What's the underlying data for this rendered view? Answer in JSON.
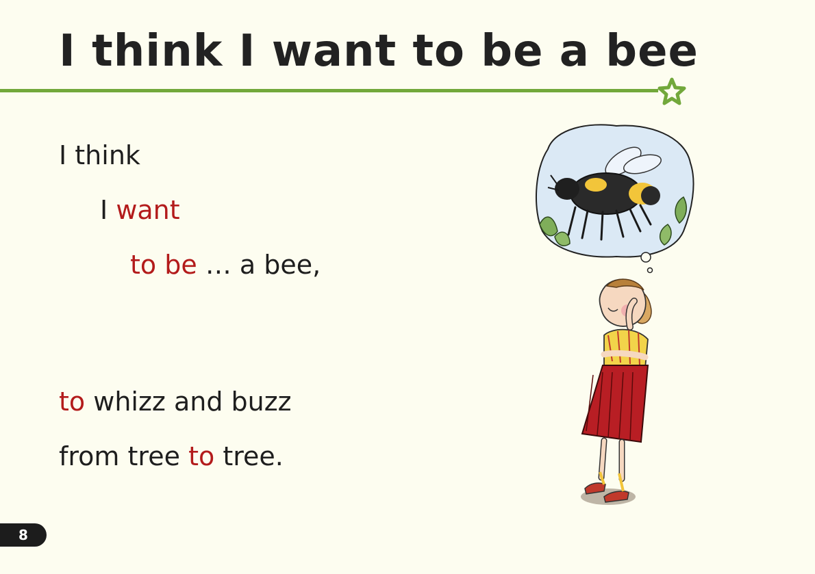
{
  "title": "I think I want to be a bee",
  "poem": {
    "line1": {
      "a": "I think"
    },
    "line2": {
      "a": "I",
      "b": "want"
    },
    "line3": {
      "a": "to be",
      "b": "… a bee,"
    },
    "line4": {
      "a": "to",
      "b": "whizz and buzz"
    },
    "line5": {
      "a": "from tree",
      "b": "to",
      "c": "tree."
    }
  },
  "page_number": "8",
  "colors": {
    "accent_green": "#72a83b",
    "highlight_red": "#b31b1b",
    "text": "#1e1e1e",
    "background": "#fdfdf0"
  },
  "illustration": {
    "subject": "girl-dreaming-of-bee-icon"
  }
}
